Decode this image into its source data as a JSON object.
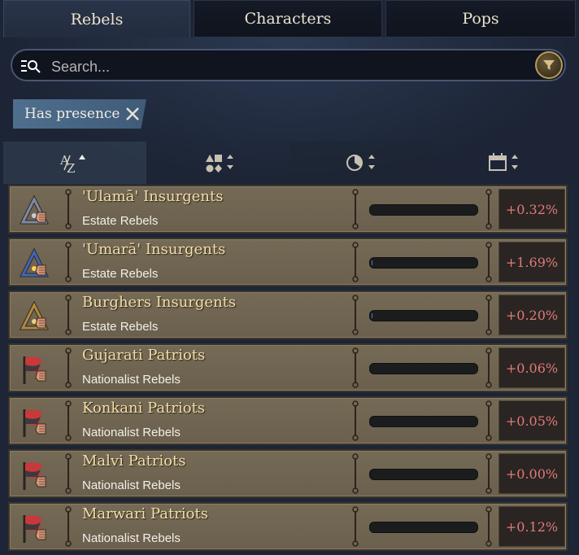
{
  "tabs": [
    {
      "label": "Rebels",
      "active": true
    },
    {
      "label": "Characters",
      "active": false
    },
    {
      "label": "Pops",
      "active": false
    }
  ],
  "search": {
    "placeholder": "Search...",
    "value": ""
  },
  "filter_chip": {
    "label": "Has presence"
  },
  "sort_buttons": [
    "sort-alphabetical-icon",
    "sort-type-icon",
    "sort-progress-icon",
    "sort-date-icon"
  ],
  "colors": {
    "value_text": "#e07a7a",
    "name_text": "#f4dfa8",
    "row_bg": "#6f6552"
  },
  "rebels": [
    {
      "name": "'Ulamā' Insurgents",
      "type": "Estate Rebels",
      "value": "+0.32%",
      "progress": 0.0,
      "icon": "estate-ulama-fist-icon"
    },
    {
      "name": "'Umarā' Insurgents",
      "type": "Estate Rebels",
      "value": "+1.69%",
      "progress": 0.01,
      "icon": "estate-umara-fist-icon"
    },
    {
      "name": "Burghers Insurgents",
      "type": "Estate Rebels",
      "value": "+0.20%",
      "progress": 0.01,
      "icon": "estate-burghers-fist-icon"
    },
    {
      "name": "Gujarati Patriots",
      "type": "Nationalist Rebels",
      "value": "+0.06%",
      "progress": 0.0,
      "icon": "nationalist-flag-fist-icon"
    },
    {
      "name": "Konkani Patriots",
      "type": "Nationalist Rebels",
      "value": "+0.05%",
      "progress": 0.0,
      "icon": "nationalist-flag-fist-icon"
    },
    {
      "name": "Malvi Patriots",
      "type": "Nationalist Rebels",
      "value": "+0.00%",
      "progress": 0.0,
      "icon": "nationalist-flag-fist-icon"
    },
    {
      "name": "Marwari Patriots",
      "type": "Nationalist Rebels",
      "value": "+0.12%",
      "progress": 0.0,
      "icon": "nationalist-flag-fist-icon"
    }
  ]
}
